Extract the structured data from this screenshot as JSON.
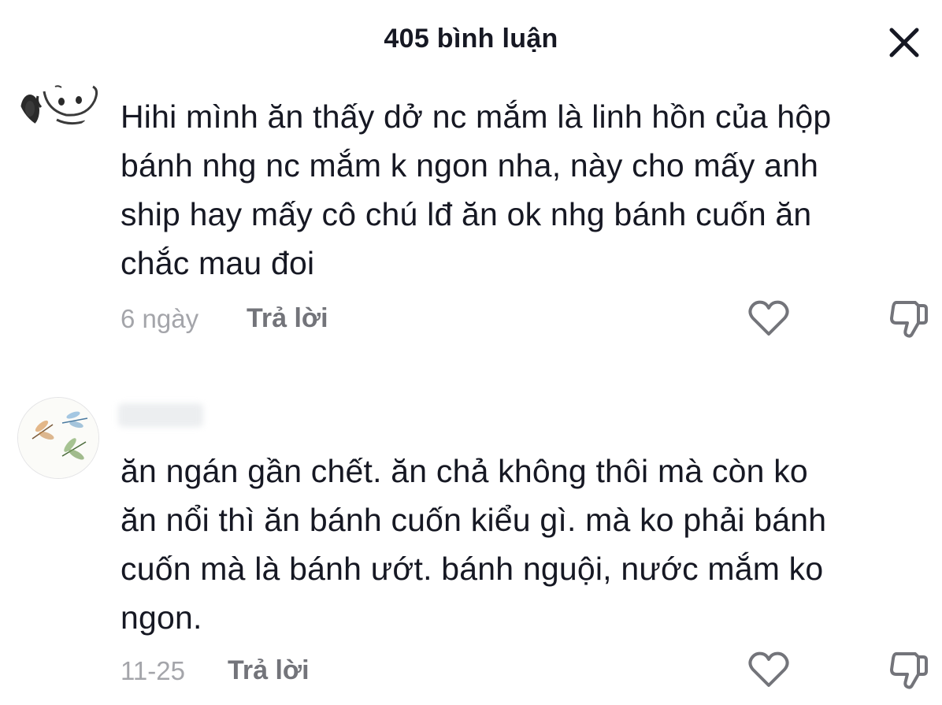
{
  "header": {
    "title": "405 bình luận",
    "close_icon": "close-icon"
  },
  "comments": [
    {
      "avatar_icon": "snoopy-avatar-icon",
      "text": "Hihi mình ăn thấy dở nc mắm là linh hồn của hộp\nbánh nhg nc mắm k ngon nha, này cho mấy anh\nship hay mấy cô chú lđ ăn ok nhg bánh cuốn ăn\nchắc mau đoi",
      "time": "6 ngày",
      "reply_label": "Trả lời",
      "like_icon": "heart-icon",
      "dislike_icon": "thumbs-down-icon"
    },
    {
      "avatar_icon": "dragonfly-avatar-icon",
      "text": "ăn ngán gần chết. ăn chả không thôi mà còn ko\năn nổi thì ăn bánh cuốn kiểu gì. mà ko phải bánh\ncuốn mà là bánh ướt. bánh nguội, nước mắm ko\nngon.",
      "time": "11-25",
      "reply_label": "Trả lời",
      "like_icon": "heart-icon",
      "dislike_icon": "thumbs-down-icon"
    }
  ],
  "colors": {
    "text_primary": "#161823",
    "text_secondary": "#a4a5aa",
    "reply": "#73747a"
  }
}
